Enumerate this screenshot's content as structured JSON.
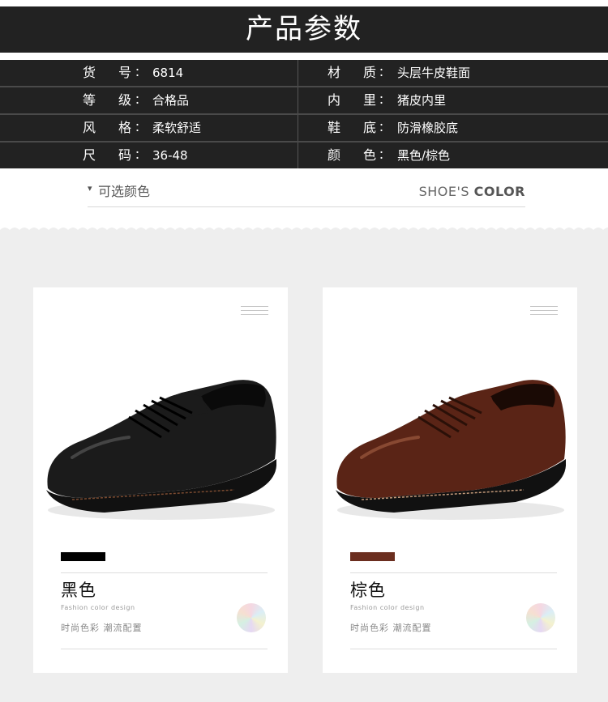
{
  "banner": {
    "title": "产品参数"
  },
  "specs": [
    {
      "label": "货号",
      "value": "6814",
      "label2": "材质",
      "value2": "头层牛皮鞋面"
    },
    {
      "label": "等级",
      "value": "合格品",
      "label2": "内里",
      "value2": "猪皮内里"
    },
    {
      "label": "风格",
      "value": "柔软舒适",
      "label2": "鞋底",
      "value2": "防滑橡胶底"
    },
    {
      "label": "尺码",
      "value": "36-48",
      "label2": "颜色",
      "value2": "黑色/棕色"
    }
  ],
  "colon": "：",
  "section": {
    "arrow": "▾",
    "left_title": "可选颜色",
    "right_light": "SHOE'S ",
    "right_bold": "COLOR"
  },
  "cards": [
    {
      "name": "黑色",
      "fashion_en": "Fashion  color  design",
      "fashion_cn": "时尚色彩   潮流配置",
      "swatch_color": "#000000",
      "shoe_color": "#1b1b1b",
      "shoe_highlight": "#555555"
    },
    {
      "name": "棕色",
      "fashion_en": "Fashion  color  design",
      "fashion_cn": "时尚色彩   潮流配置",
      "swatch_color": "#6b2e1f",
      "shoe_color": "#5a2416",
      "shoe_highlight": "#9b5a3e"
    }
  ],
  "icons": {
    "menu": "menu-lines-icon",
    "holo": "hologram-sticker-icon"
  }
}
